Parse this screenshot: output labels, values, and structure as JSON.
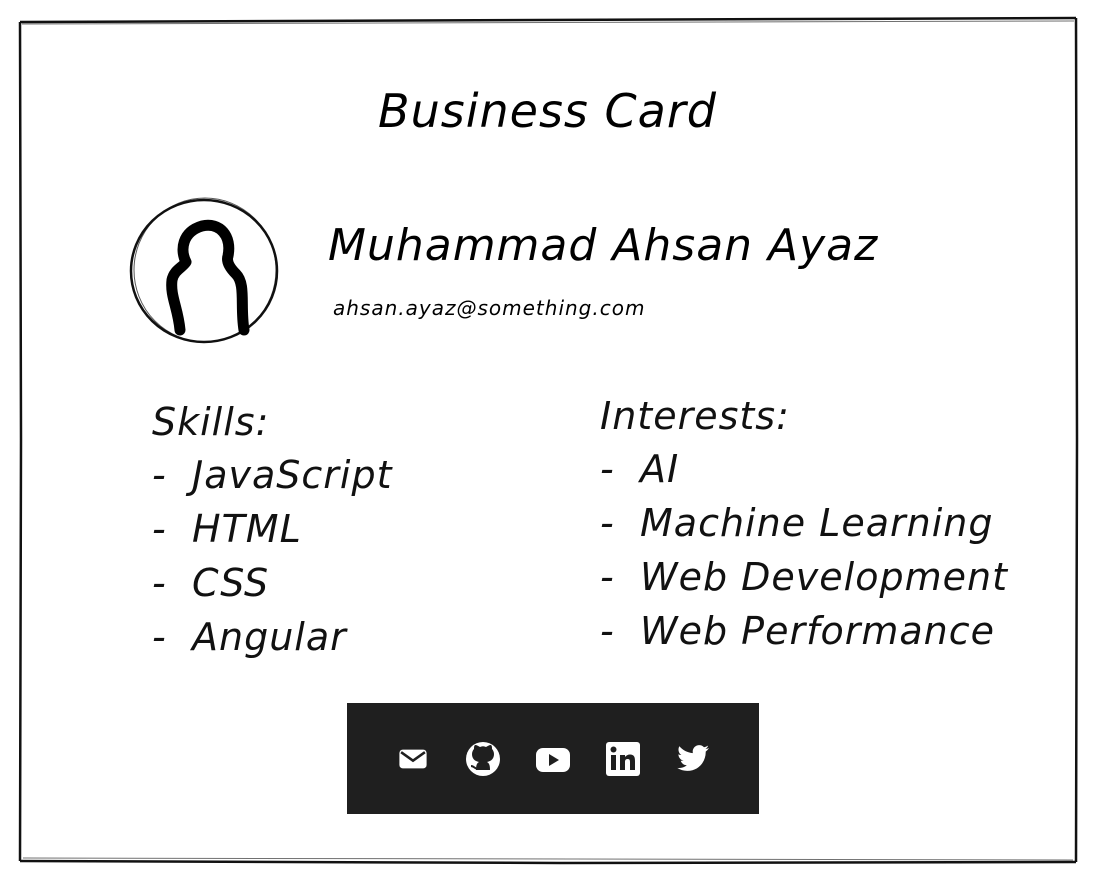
{
  "card": {
    "title": "Business Card",
    "name": "Muhammad Ahsan Ayaz",
    "email": "ahsan.ayaz@something.com"
  },
  "skills": {
    "heading": "Skills:",
    "items": [
      "JavaScript",
      "HTML",
      "CSS",
      "Angular"
    ]
  },
  "interests": {
    "heading": "Interests:",
    "items": [
      "AI",
      "Machine Learning",
      "Web Development",
      "Web Performance"
    ]
  },
  "bullet": "-",
  "social": {
    "background": "#1f1f1f",
    "icon_color": "#ffffff",
    "icons": [
      "email-icon",
      "github-icon",
      "youtube-icon",
      "linkedin-icon",
      "twitter-icon"
    ]
  }
}
